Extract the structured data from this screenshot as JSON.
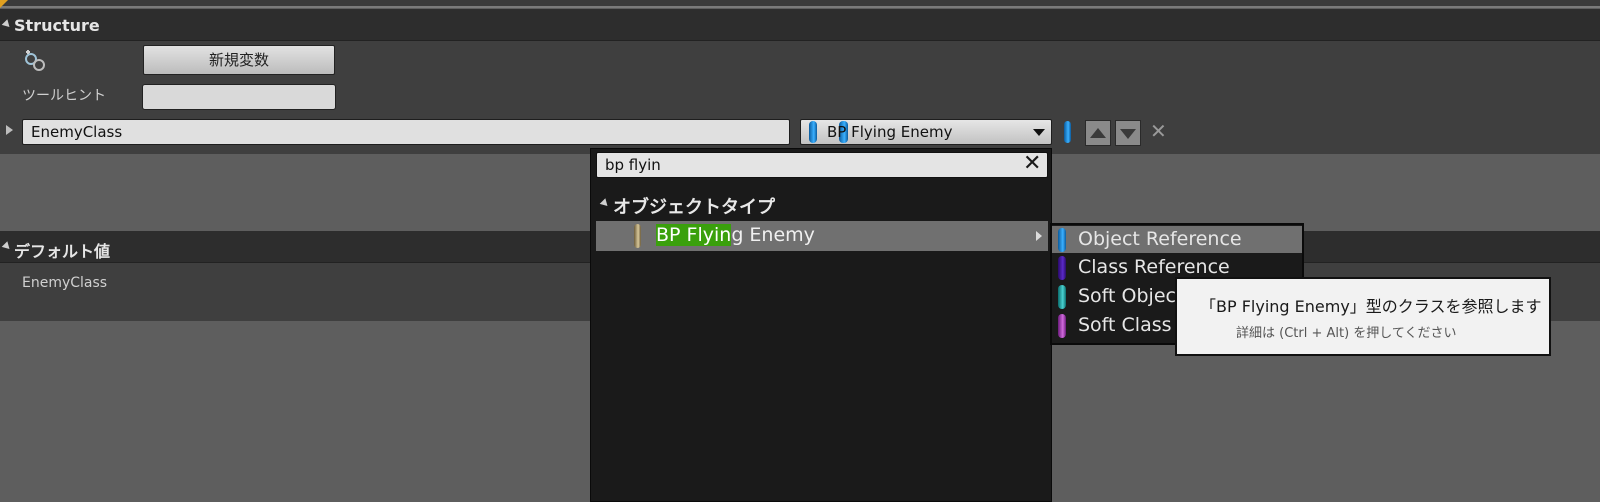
{
  "structure": {
    "title": "Structure",
    "new_variable_button": "新規変数",
    "tooltip_label": "ツールヒント",
    "tooltip_value": "",
    "variable_name": "EnemyClass",
    "variable_type": "BP Flying Enemy"
  },
  "defaults": {
    "title": "デフォルト値",
    "row_label": "EnemyClass"
  },
  "type_picker": {
    "search_text": "bp flyin",
    "category": "オブジェクトタイプ",
    "result_highlight": "BP Flyin",
    "result_rest": "g Enemy"
  },
  "submenu": {
    "items": [
      "Object Reference",
      "Class Reference",
      "Soft Object Reference",
      "Soft Class Reference"
    ]
  },
  "tooltip": {
    "main": "「BP Flying Enemy」型のクラスを参照します",
    "sub": "詳細は (Ctrl + Alt) を押してください"
  },
  "colors": {
    "object_reference": "#3ab0ff",
    "class_reference": "#5a2ac8",
    "soft_object_reference": "#4ad0d0",
    "soft_class_reference": "#d06adc",
    "search_highlight": "#3aa00c"
  }
}
